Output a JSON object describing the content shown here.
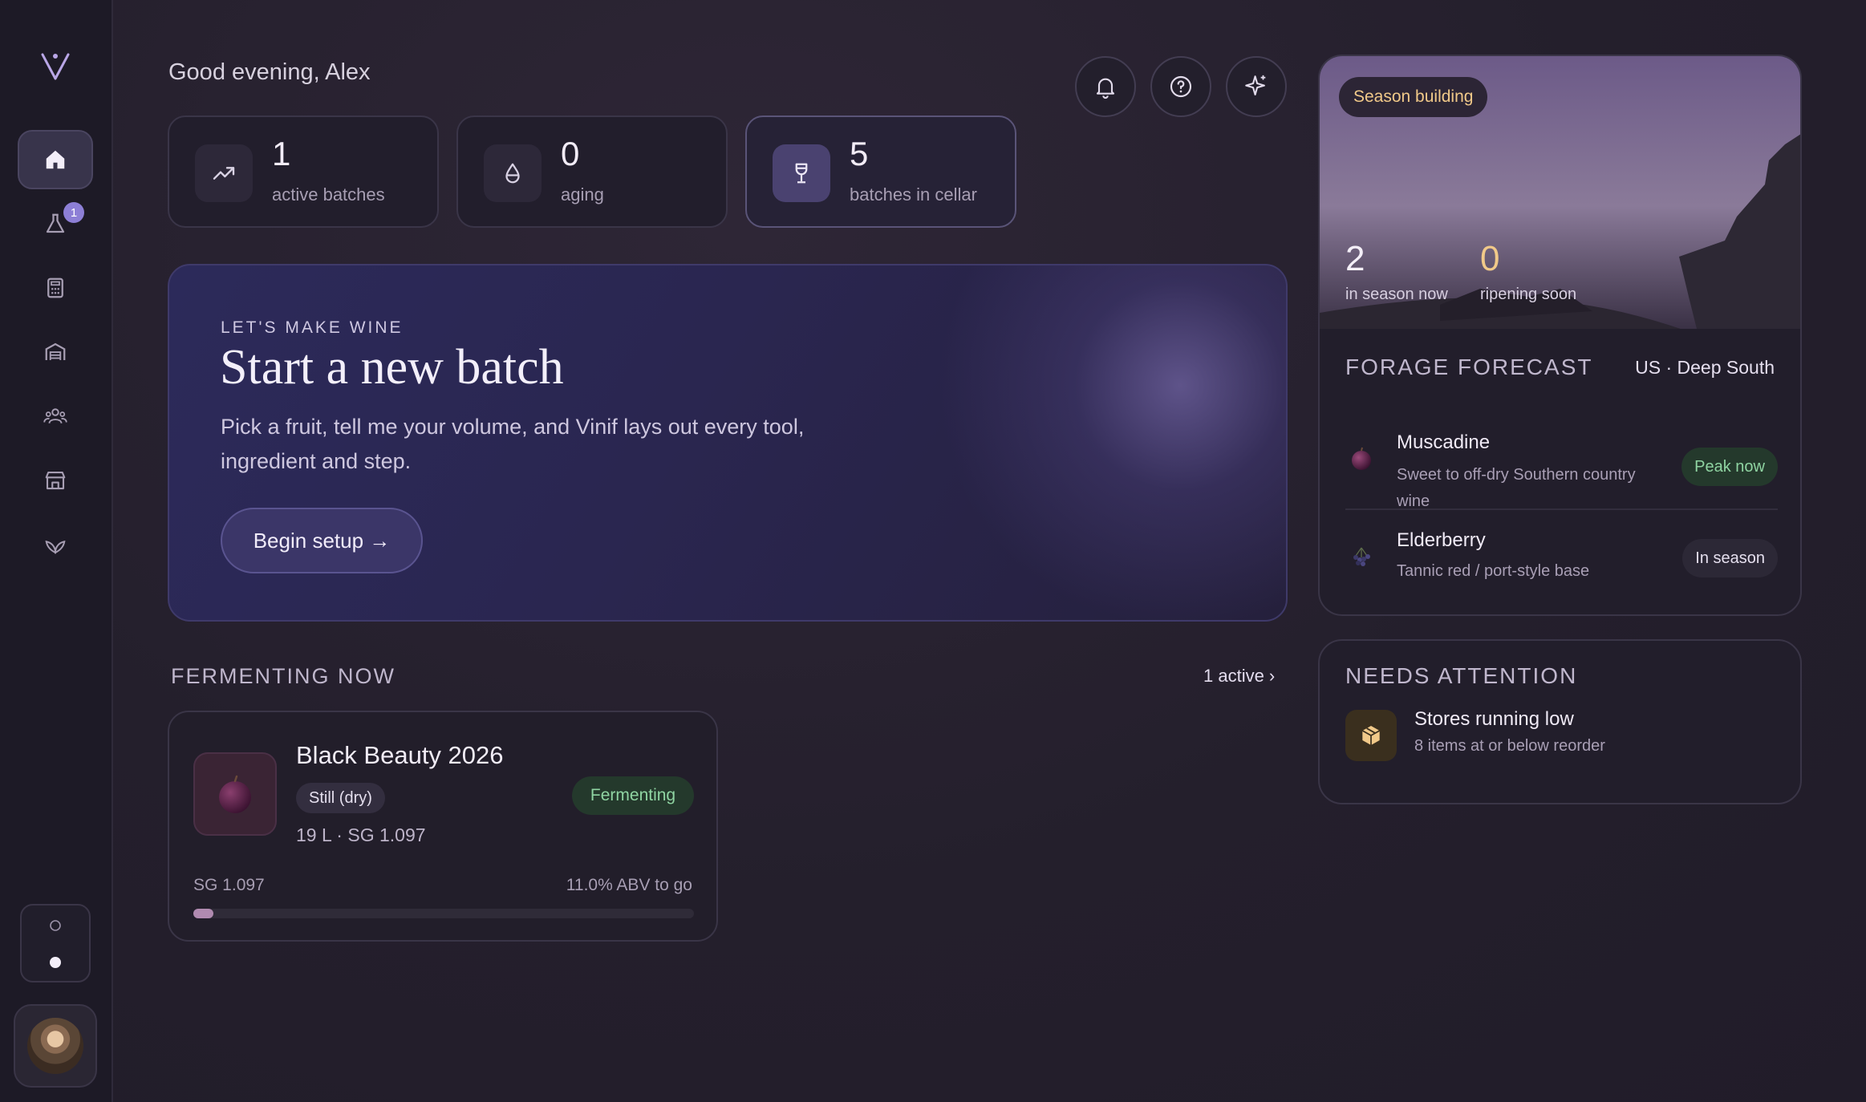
{
  "user": {
    "greeting": "Good evening, Alex"
  },
  "sidebar": {
    "items": [
      {
        "icon": "home-icon",
        "active": true
      },
      {
        "icon": "flask-icon",
        "badge": "1"
      },
      {
        "icon": "calculator-icon"
      },
      {
        "icon": "warehouse-icon"
      },
      {
        "icon": "users-icon"
      },
      {
        "icon": "store-icon"
      },
      {
        "icon": "leaf-icon"
      }
    ],
    "theme_options": [
      "light-mode",
      "dark-mode"
    ],
    "theme_selected": "dark-mode"
  },
  "stats": [
    {
      "value": "1",
      "label": "active batches",
      "icon": "trend-up-icon"
    },
    {
      "value": "0",
      "label": "aging",
      "icon": "droplet-icon"
    },
    {
      "value": "5",
      "label": "batches in cellar",
      "icon": "wine-glass-icon"
    }
  ],
  "header_actions": [
    "bell-icon",
    "help-icon",
    "sparkle-icon"
  ],
  "hero": {
    "eyebrow": "LET'S MAKE WINE",
    "title": "Start a new batch",
    "description": "Pick a fruit, tell me your volume, and Vinif lays out every tool, ingredient and step.",
    "button": "Begin setup →"
  },
  "fermenting": {
    "title": "FERMENTING NOW",
    "link": "1 active ›",
    "batch": {
      "name": "Black Beauty 2026",
      "tag": "Still (dry)",
      "meta": "19 L · SG 1.097",
      "status": "Fermenting",
      "sg": "SG 1.097",
      "abv_remaining": "11.0% ABV to go",
      "progress": 0.04
    }
  },
  "season": {
    "pill": "Season building",
    "in_season": "2",
    "in_season_label": "in season now",
    "ripening": "0",
    "ripening_label": "ripening soon"
  },
  "forecast": {
    "title": "FORAGE FORECAST",
    "region": "US · Deep South",
    "items": [
      {
        "name": "Muscadine",
        "desc": "Sweet to off-dry Southern country wine",
        "status": "Peak now",
        "icon": "grape-icon"
      },
      {
        "name": "Elderberry",
        "desc": "Tannic red / port-style base",
        "status": "In season",
        "icon": "elderberry-icon"
      }
    ]
  },
  "attention": {
    "title": "NEEDS ATTENTION",
    "items": [
      {
        "name": "Stores running low",
        "desc": "8 items at or below reorder",
        "icon": "package-icon"
      }
    ]
  },
  "colors": {
    "accent": "#8d7fd6",
    "success": "#8fd4a2",
    "warning": "#f1c989",
    "background": "#241f2c"
  }
}
